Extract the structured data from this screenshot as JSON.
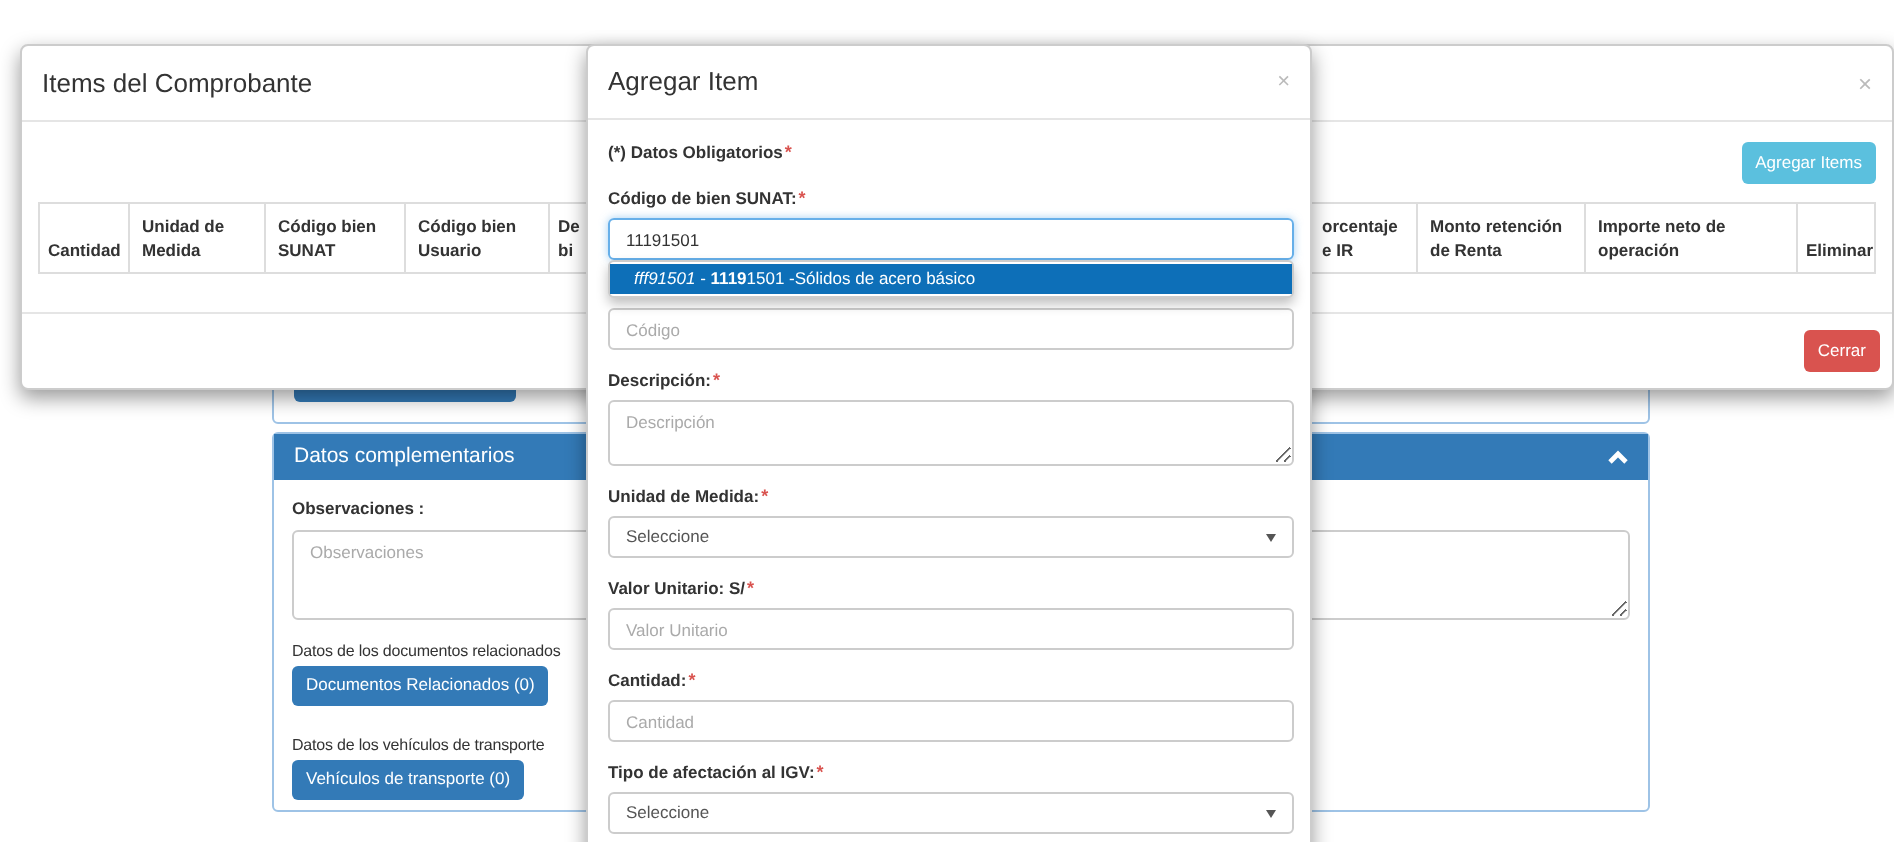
{
  "background_page": {
    "complementary_panel": {
      "title": "Datos complementarios",
      "expanded": true,
      "observations_label": "Observaciones :",
      "observations_placeholder": "Observaciones",
      "sections": [
        {
          "text": "Datos de los documentos relacionados",
          "button": "Documentos Relacionados (0)"
        },
        {
          "text": "Datos de los vehículos de transporte",
          "button": "Vehículos de transporte (0)"
        }
      ]
    }
  },
  "items_modal": {
    "title": "Items del Comprobante",
    "close": "×",
    "add_button": "Agregar Items",
    "columns": [
      "Cantidad",
      "Unidad de Medida",
      "Código bien SUNAT",
      "Código bien Usuario",
      "De bi",
      "orcentaje e IR",
      "Monto retención de Renta",
      "Importe neto de operación",
      "Eliminar"
    ],
    "close_button": "Cerrar"
  },
  "add_item_modal": {
    "title": "Agregar Item",
    "close": "×",
    "required_note": "(*) Datos Obligatorios",
    "required_mark": "*",
    "fields": [
      {
        "kind": "input",
        "label": "Código de bien SUNAT:",
        "required": true,
        "value": "11191501",
        "focused": true,
        "suggestions": [
          {
            "text": "*fff91501* - **1119**1501 -Sólidos de acero básico",
            "selected": true
          }
        ]
      },
      {
        "kind": "input",
        "placeholder": "Código",
        "focused": false
      },
      {
        "kind": "textarea",
        "label": "Descripción:",
        "required": true,
        "placeholder": "Descripción",
        "focused": false
      },
      {
        "kind": "select",
        "label": "Unidad de Medida:",
        "required": true,
        "value": "Seleccione",
        "focused": false
      },
      {
        "kind": "input",
        "label": "Valor Unitario: S/",
        "required": true,
        "placeholder": "Valor Unitario",
        "focused": false
      },
      {
        "kind": "input",
        "label": "Cantidad:",
        "required": true,
        "placeholder": "Cantidad",
        "focused": false
      },
      {
        "kind": "select",
        "label": "Tipo de afectación al IGV:",
        "required": true,
        "value": "Seleccione",
        "focused": false
      }
    ]
  }
}
